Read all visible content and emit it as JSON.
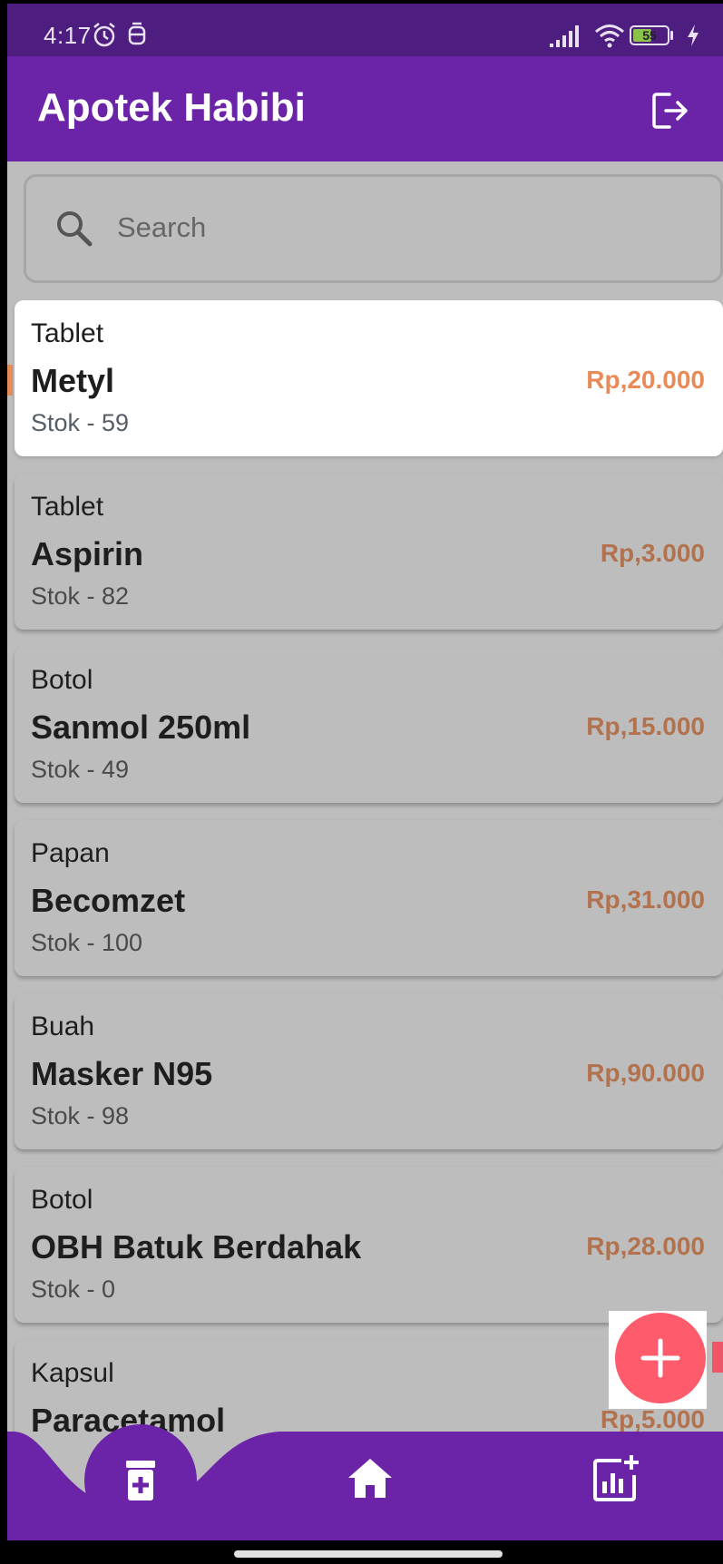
{
  "status_bar": {
    "time": "4:17",
    "battery": "55",
    "battery_level": 0.55,
    "icons": [
      "alarm-icon",
      "notification-icon",
      "signal-icon",
      "wifi-icon",
      "battery-icon",
      "charging-icon"
    ]
  },
  "app_bar": {
    "title": "Apotek Habibi",
    "logout_icon": "logout-icon"
  },
  "search": {
    "placeholder": "Search",
    "icon": "search-icon"
  },
  "products": [
    {
      "category": "Tablet",
      "name": "Metyl",
      "stock": "Stok - 59",
      "price": "Rp,20.000",
      "highlighted": true
    },
    {
      "category": "Tablet",
      "name": "Aspirin",
      "stock": "Stok - 82",
      "price": "Rp,3.000"
    },
    {
      "category": "Botol",
      "name": "Sanmol 250ml",
      "stock": "Stok - 49",
      "price": "Rp,15.000"
    },
    {
      "category": "Papan",
      "name": "Becomzet",
      "stock": "Stok - 100",
      "price": "Rp,31.000"
    },
    {
      "category": "Buah",
      "name": "Masker N95",
      "stock": "Stok - 98",
      "price": "Rp,90.000"
    },
    {
      "category": "Botol",
      "name": "OBH Batuk Berdahak",
      "stock": "Stok - 0",
      "price": "Rp,28.000"
    },
    {
      "category": "Kapsul",
      "name": "Paracetamol",
      "stock": "",
      "price": "Rp,5.000"
    }
  ],
  "fab": {
    "icon": "plus-icon"
  },
  "bottom_nav": {
    "items": [
      {
        "icon": "medicine-icon",
        "active": true
      },
      {
        "icon": "home-icon",
        "active": false
      },
      {
        "icon": "add-chart-icon",
        "active": false
      }
    ]
  },
  "colors": {
    "primary": "#6b24a7",
    "status_bar": "#4e1d80",
    "price": "#b3724e",
    "price_highlight": "#e98b58",
    "fab": "#fe5c6c",
    "overlay_bg": "#bdbdbd"
  }
}
